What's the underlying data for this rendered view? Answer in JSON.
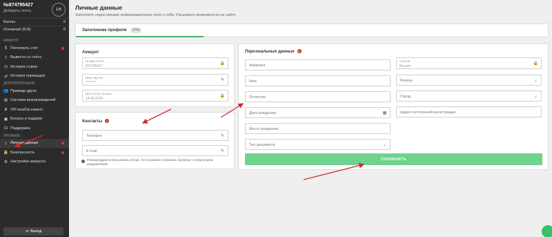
{
  "sidebar": {
    "account_id": "№874795427",
    "add_email": "Добавить почту",
    "progress": "1/6",
    "balances": [
      {
        "label": "Баллы",
        "value": "0"
      },
      {
        "label": "Основной (R.B)",
        "value": "0"
      }
    ],
    "section_account": "АККАУНТ",
    "account_items": [
      {
        "label": "Пополнить счёт",
        "icon": "dollar-icon"
      },
      {
        "label": "Вывести со счёта",
        "icon": "withdraw-icon"
      },
      {
        "label": "История ставок",
        "icon": "history-icon"
      },
      {
        "label": "История переводов",
        "icon": "transfer-icon"
      }
    ],
    "section_extra": "ДОПОЛНИТЕЛЬНО",
    "extra_items": [
      {
        "label": "Приведи друга",
        "icon": "users-icon"
      },
      {
        "label": "Система вознаграждений",
        "icon": "reward-icon"
      },
      {
        "label": "VIP кешбэк казино",
        "icon": "vip-icon"
      },
      {
        "label": "Бонусы и подарки",
        "icon": "gift-icon"
      },
      {
        "label": "Поддержка",
        "icon": "support-icon"
      }
    ],
    "section_profile": "ПРОФИЛЬ",
    "profile_items": [
      {
        "label": "Личные данные",
        "icon": "user-icon"
      },
      {
        "label": "Безопасность",
        "icon": "lock-icon"
      },
      {
        "label": "Настройки аккаунта",
        "icon": "gear-icon"
      }
    ],
    "logout": "Выход"
  },
  "header": {
    "title": "Личные данные",
    "subtitle": "Заполните недостающие информационные поля о себе. Расширьте возможности на сайте."
  },
  "tabs": {
    "label": "Заполнение профиля",
    "badge": "27%",
    "progress_percent": 27
  },
  "account": {
    "title": "Аккаунт",
    "fields": [
      {
        "label": "Номер счёта",
        "value": "874795427"
      },
      {
        "label": "Ваш пароль",
        "value": "********"
      },
      {
        "label": "Дата регистрации",
        "value": "14.05.2024"
      }
    ]
  },
  "contacts": {
    "title": "Контакты",
    "phone": "Телефон",
    "email": "E-mail",
    "note": "Рекомендуем использовать Gmail. Это позволит избежать проблем с получением уведомлений"
  },
  "personal": {
    "title": "Персональные данные",
    "left_fields": [
      "Фамилия",
      "Имя",
      "Отчество",
      "Дата рождения",
      "Место рождения",
      "Тип документа"
    ],
    "country_label": "Страна",
    "country_value": "Россия",
    "region": "Регион",
    "city": "Город",
    "address": "Адрес постоянной регистрации",
    "save": "СОХРАНИТЬ"
  },
  "colors": {
    "sidebar_bg": "#2b2b2b",
    "accent_green": "#6fd28e",
    "warn_red": "#c0392b",
    "arrow_red": "#d42a2a"
  }
}
